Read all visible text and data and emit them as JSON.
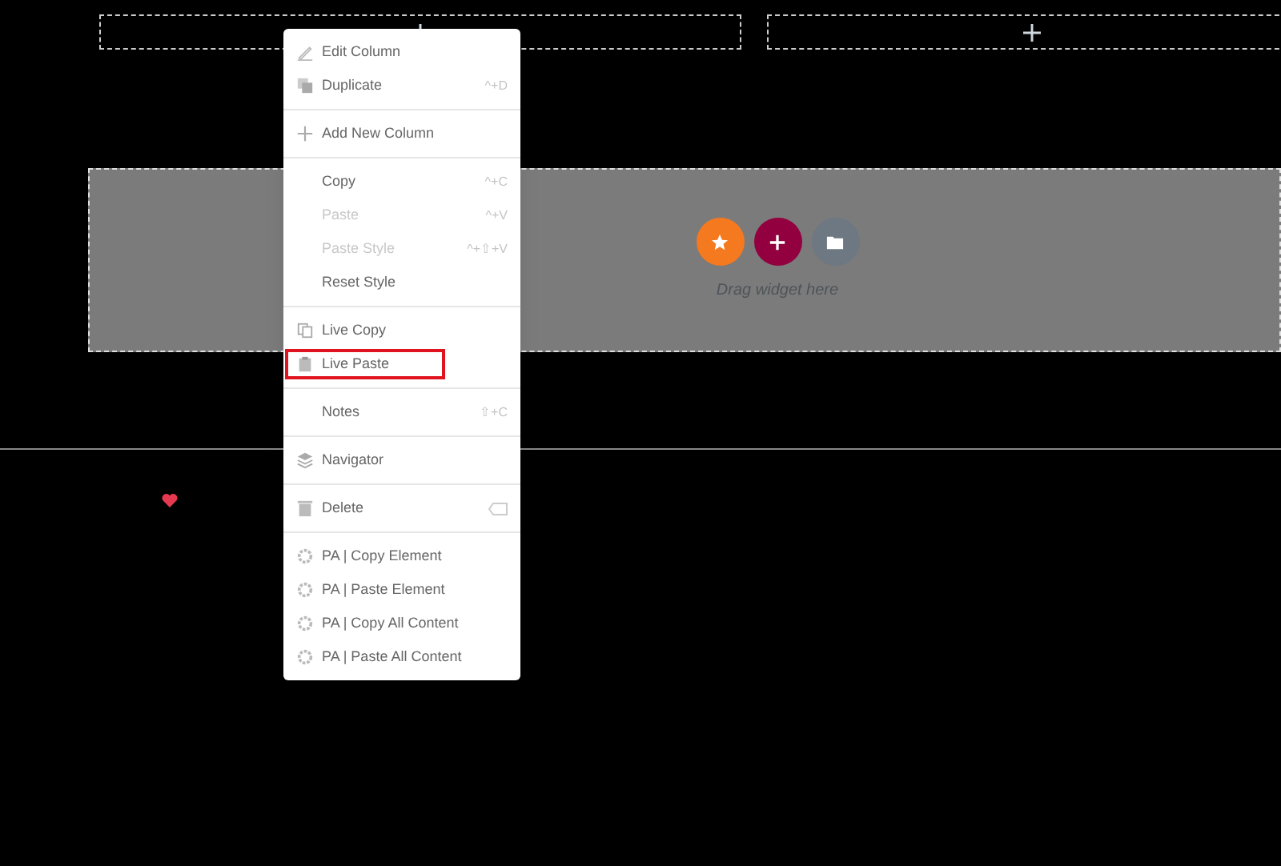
{
  "columns": [
    {
      "kind": "add"
    },
    {
      "kind": "add"
    }
  ],
  "section": {
    "hint": "Drag widget here"
  },
  "context_menu": {
    "groups": [
      {
        "items": [
          {
            "label": "Edit Column",
            "disabled": false,
            "highlighted": false
          },
          {
            "label": "Duplicate",
            "shortcut": "^+D",
            "disabled": false,
            "highlighted": false
          }
        ]
      },
      {
        "items": [
          {
            "label": "Add New Column",
            "disabled": false,
            "highlighted": false
          }
        ]
      },
      {
        "items": [
          {
            "label": "Copy",
            "shortcut": "^+C",
            "disabled": false,
            "highlighted": false
          },
          {
            "label": "Paste",
            "shortcut": "^+V",
            "disabled": true,
            "highlighted": false
          },
          {
            "label": "Paste Style",
            "shortcut": "^+⇧+V",
            "disabled": true,
            "highlighted": false
          },
          {
            "label": "Reset Style",
            "disabled": false,
            "highlighted": false
          }
        ]
      },
      {
        "items": [
          {
            "label": "Live Copy",
            "disabled": false,
            "highlighted": false
          },
          {
            "label": "Live Paste",
            "disabled": false,
            "highlighted": true
          }
        ]
      },
      {
        "items": [
          {
            "label": "Notes",
            "shortcut": "⇧+C",
            "disabled": false,
            "highlighted": false
          }
        ]
      },
      {
        "items": [
          {
            "label": "Navigator",
            "disabled": false,
            "highlighted": false
          }
        ]
      },
      {
        "items": [
          {
            "label": "Delete",
            "disabled": false,
            "highlighted": false
          }
        ]
      },
      {
        "items": [
          {
            "label": "PA | Copy Element",
            "disabled": false,
            "highlighted": false
          },
          {
            "label": "PA | Paste Element",
            "disabled": false,
            "highlighted": false
          },
          {
            "label": "PA | Copy All Content",
            "disabled": false,
            "highlighted": false
          },
          {
            "label": "PA | Paste All Content",
            "disabled": false,
            "highlighted": false
          }
        ]
      }
    ]
  }
}
